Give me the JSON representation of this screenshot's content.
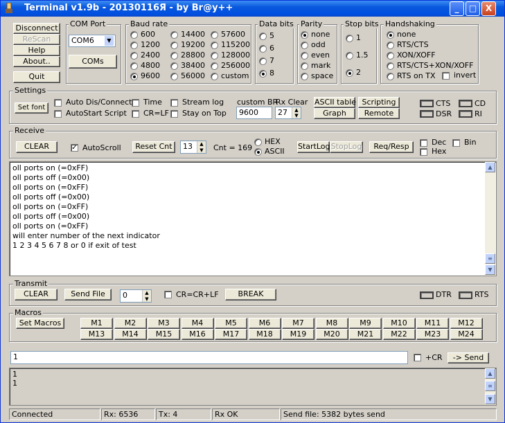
{
  "title": "Terminal v1.9b - 20130116Я - by Br@y++",
  "window_buttons": {
    "min": "_",
    "max": "□",
    "close": "X"
  },
  "left_buttons": {
    "disconnect": "Disconnect",
    "rescan": "ReScan",
    "help": "Help",
    "about": "About..",
    "quit": "Quit"
  },
  "com_port": {
    "group": "COM Port",
    "value": "COM6",
    "coms_button": "COMs"
  },
  "baud": {
    "group": "Baud rate",
    "options": [
      "600",
      "1200",
      "2400",
      "4800",
      "9600",
      "14400",
      "19200",
      "28800",
      "38400",
      "56000",
      "57600",
      "115200",
      "128000",
      "256000",
      "custom"
    ],
    "selected": "9600"
  },
  "data_bits": {
    "group": "Data bits",
    "options": [
      "5",
      "6",
      "7",
      "8"
    ],
    "selected": "8"
  },
  "parity": {
    "group": "Parity",
    "options": [
      "none",
      "odd",
      "even",
      "mark",
      "space"
    ],
    "selected": "none"
  },
  "stop_bits": {
    "group": "Stop bits",
    "options": [
      "1",
      "1.5",
      "2"
    ],
    "selected": "2"
  },
  "handshaking": {
    "group": "Handshaking",
    "options": [
      "none",
      "RTS/CTS",
      "XON/XOFF",
      "RTS/CTS+XON/XOFF",
      "RTS on TX"
    ],
    "invert": "invert",
    "selected": "none"
  },
  "settings": {
    "group": "Settings",
    "set_font": "Set font",
    "auto_dis": "Auto Dis/Connect",
    "autostart": "AutoStart Script",
    "time": "Time",
    "crlf": "CR=LF",
    "stream_log": "Stream log",
    "stay_on_top": "Stay on Top",
    "custom_br_label": "custom BR",
    "custom_br_value": "9600",
    "rx_clear_label": "Rx Clear",
    "rx_clear_value": "27",
    "ascii_table": "ASCII table",
    "graph": "Graph",
    "scripting": "Scripting",
    "remote": "Remote",
    "cts": "CTS",
    "cd": "CD",
    "dsr": "DSR",
    "ri": "RI"
  },
  "receive": {
    "group": "Receive",
    "clear": "CLEAR",
    "autoscroll": "AutoScroll",
    "reset_cnt": "Reset Cnt",
    "cnt_spin": "13",
    "cnt": "Cnt =  169",
    "hex": "HEX",
    "ascii": "ASCII",
    "startlog": "StartLog",
    "stoplog": "StopLog",
    "reqresp": "Req/Resp",
    "dec": "Dec",
    "hex2": "Hex",
    "bin": "Bin",
    "lines": [
      "oll ports on (=0xFF)",
      "oll ports off (=0x00)",
      "oll ports on (=0xFF)",
      "oll ports off (=0x00)",
      "oll ports on (=0xFF)",
      "oll ports off (=0x00)",
      "oll ports on (=0xFF)",
      "will enter number of the next indicator",
      " 1 2 3 4 5 6 7 8 or 0 if exit of test"
    ]
  },
  "transmit": {
    "group": "Transmit",
    "clear": "CLEAR",
    "send_file": "Send File",
    "spin": "0",
    "crcrlf": "CR=CR+LF",
    "break": "BREAK",
    "dtr": "DTR",
    "rts": "RTS"
  },
  "macros": {
    "group": "Macros",
    "set_macros": "Set Macros",
    "keys": [
      "M1",
      "M2",
      "M3",
      "M4",
      "M5",
      "M6",
      "M7",
      "M8",
      "M9",
      "M10",
      "M11",
      "M12",
      "M13",
      "M14",
      "M15",
      "M16",
      "M17",
      "M18",
      "M19",
      "M20",
      "M21",
      "M22",
      "M23",
      "M24"
    ]
  },
  "send": {
    "input": "1",
    "plus_cr": "+CR",
    "send_button": "-> Send"
  },
  "transmit_log": [
    "1",
    "1"
  ],
  "statusbar": {
    "conn": "Connected",
    "rx": "Rx: 6536",
    "tx": "Tx: 4",
    "rxok": "Rx OK",
    "sendfile": "Send file: 5382 bytes send"
  }
}
